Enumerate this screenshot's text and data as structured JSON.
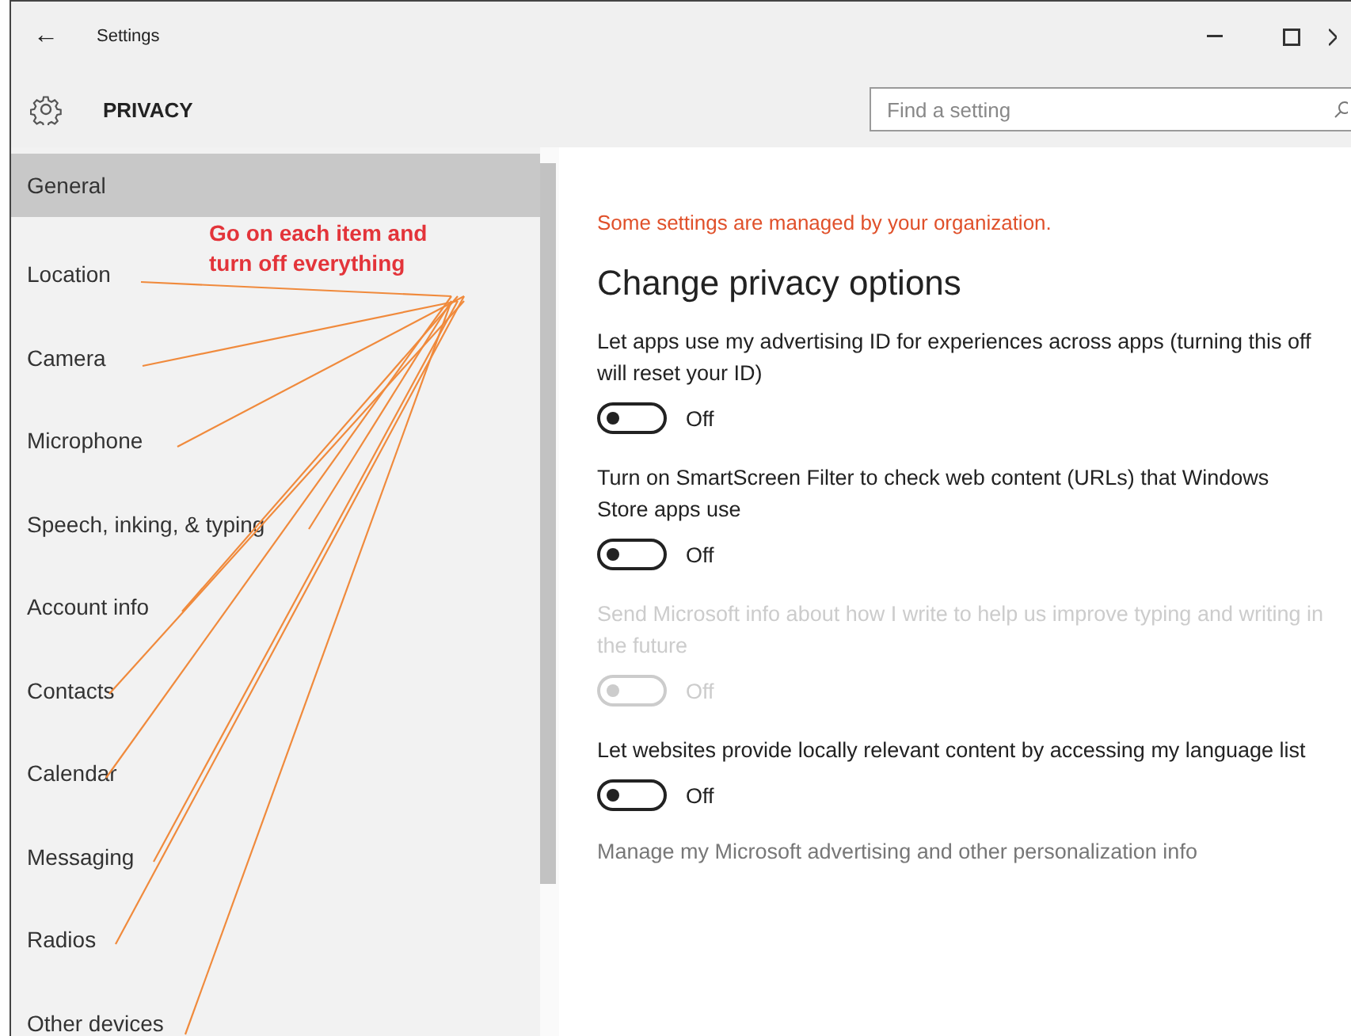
{
  "window": {
    "back": "←",
    "title": "Settings"
  },
  "header": {
    "title": "PRIVACY",
    "search": {
      "placeholder": "Find a setting"
    }
  },
  "sidebar": {
    "items": [
      {
        "label": "General",
        "selected": true
      },
      {
        "label": "Location",
        "selected": false
      },
      {
        "label": "Camera",
        "selected": false
      },
      {
        "label": "Microphone",
        "selected": false
      },
      {
        "label": "Speech, inking, & typing",
        "selected": false
      },
      {
        "label": "Account info",
        "selected": false
      },
      {
        "label": "Contacts",
        "selected": false
      },
      {
        "label": "Calendar",
        "selected": false
      },
      {
        "label": "Messaging",
        "selected": false
      },
      {
        "label": "Radios",
        "selected": false
      },
      {
        "label": "Other devices",
        "selected": false
      }
    ]
  },
  "annotation": {
    "text": "Go on each item and turn off everything"
  },
  "content": {
    "notice": "Some settings are managed by your organization.",
    "heading": "Change privacy options",
    "options": [
      {
        "kind": "toggle",
        "label": "Let apps use my advertising ID for experiences across apps (turning this off will reset your ID)",
        "on": false,
        "state": "Off",
        "disabled": false
      },
      {
        "kind": "toggle",
        "label": "Turn on SmartScreen Filter to check web content (URLs) that Windows Store apps use",
        "on": false,
        "state": "Off",
        "disabled": false
      },
      {
        "kind": "toggle",
        "label": "Send Microsoft info about how I write to help us improve typing and writing in the future",
        "on": false,
        "state": "Off",
        "disabled": true
      },
      {
        "kind": "toggle",
        "label": "Let websites provide locally relevant content by accessing my language list",
        "on": false,
        "state": "Off",
        "disabled": false
      },
      {
        "kind": "link",
        "label": "Manage my Microsoft advertising and other personalization info"
      }
    ]
  }
}
